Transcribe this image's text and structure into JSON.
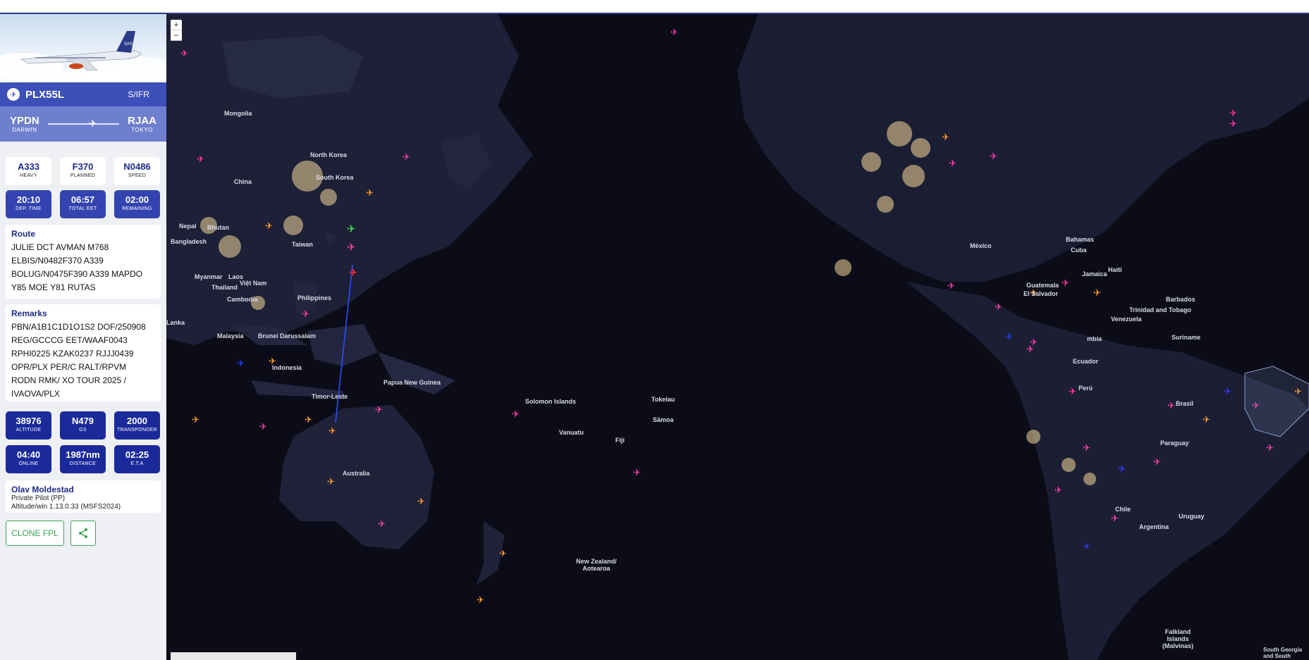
{
  "flight": {
    "callsign": "PLX55L",
    "flight_rules": "S/IFR",
    "departure": {
      "icao": "YPDN",
      "city": "DARWIN"
    },
    "arrival": {
      "icao": "RJAA",
      "city": "TOKYO"
    }
  },
  "info_tiles_top": [
    {
      "value": "A333",
      "label": "HEAVY"
    },
    {
      "value": "F370",
      "label": "PLANNED"
    },
    {
      "value": "N0486",
      "label": "SPEED"
    }
  ],
  "time_tiles": [
    {
      "value": "20:10",
      "label": "DEP. TIME"
    },
    {
      "value": "06:57",
      "label": "TOTAL EET"
    },
    {
      "value": "02:00",
      "label": "REMAINING"
    }
  ],
  "route": {
    "title": "Route",
    "lines": [
      "JULIE DCT AVMAN M768",
      "ELBIS/N0482F370 A339",
      "BOLUG/N0475F390 A339 MAPDO",
      "Y85 MOE Y81 RUTAS"
    ]
  },
  "remarks": {
    "title": "Remarks",
    "lines": [
      "PBN/A1B1C1D1O1S2 DOF/250908",
      "REG/GCCCG EET/WAAF0043",
      "RPHI0225 KZAK0237 RJJJ0439",
      "OPR/PLX PER/C RALT/RPVM",
      "RODN RMK/ XO TOUR 2025 /",
      "IVAOVA/PLX"
    ]
  },
  "live_tiles_top": [
    {
      "value": "38976",
      "label": "ALTITUDE"
    },
    {
      "value": "N479",
      "label": "GS"
    },
    {
      "value": "2000",
      "label": "TRANSPONDER"
    }
  ],
  "live_tiles_bottom": [
    {
      "value": "04:40",
      "label": "ONLINE"
    },
    {
      "value": "1987nm",
      "label": "DISTANCE"
    },
    {
      "value": "02:25",
      "label": "E.T.A"
    }
  ],
  "pilot": {
    "name": "Olav Moldestad",
    "rating": "Private Pilot (PP)",
    "client": "Altitude/win 1.13.0.33 (MSFS2024)"
  },
  "buttons": {
    "clone": "CLONE FPL",
    "share_icon": "share-icon"
  },
  "map": {
    "zoom_in": "+",
    "zoom_out": "−",
    "labels": {
      "mongolia": "Mongolia",
      "china": "China",
      "north_korea": "North Korea",
      "south_korea": "South Korea",
      "nepal": "Nepal",
      "bhutan": "Bhutan",
      "bangladesh": "Bangladesh",
      "myanmar": "Myanmar",
      "laos": "Laos",
      "thailand": "Thailand",
      "vietnam": "Việt Nam",
      "cambodia": "Cambodia",
      "taiwan": "Taiwan",
      "philippines": "Philippines",
      "malaysia": "Malaysia",
      "brunei": "Brunei Darussalam",
      "indonesia": "Indonesia",
      "timor": "Timor-Leste",
      "png": "Papua New Guinea",
      "solomon": "Solomon Islands",
      "vanuatu": "Vanuatu",
      "fiji": "Fiji",
      "tokelau": "Tokelau",
      "samoa": "Sāmoa",
      "australia": "Australia",
      "nz": "New Zealand/ Aotearoa",
      "lanka": "Lanka",
      "mexico": "México",
      "bahamas": "Bahamas",
      "cuba": "Cuba",
      "haiti": "Haiti",
      "jamaica": "Jamaica",
      "guatemala": "Guatemala",
      "el_salvador": "El Salvador",
      "barbados": "Barbados",
      "trinidad": "Trinidad and Tobago",
      "venezuela": "Venezuela",
      "colombia": "mbia",
      "suriname": "Suriname",
      "ecuador": "Ecuador",
      "peru": "Perú",
      "brasil": "Brasil",
      "paraguay": "Paraguay",
      "chile": "Chile",
      "uruguay": "Uruguay",
      "argentina": "Argentina",
      "falkland": "Falkland Islands (Malvinas)",
      "south_georgia": "South Georgia and South"
    }
  }
}
